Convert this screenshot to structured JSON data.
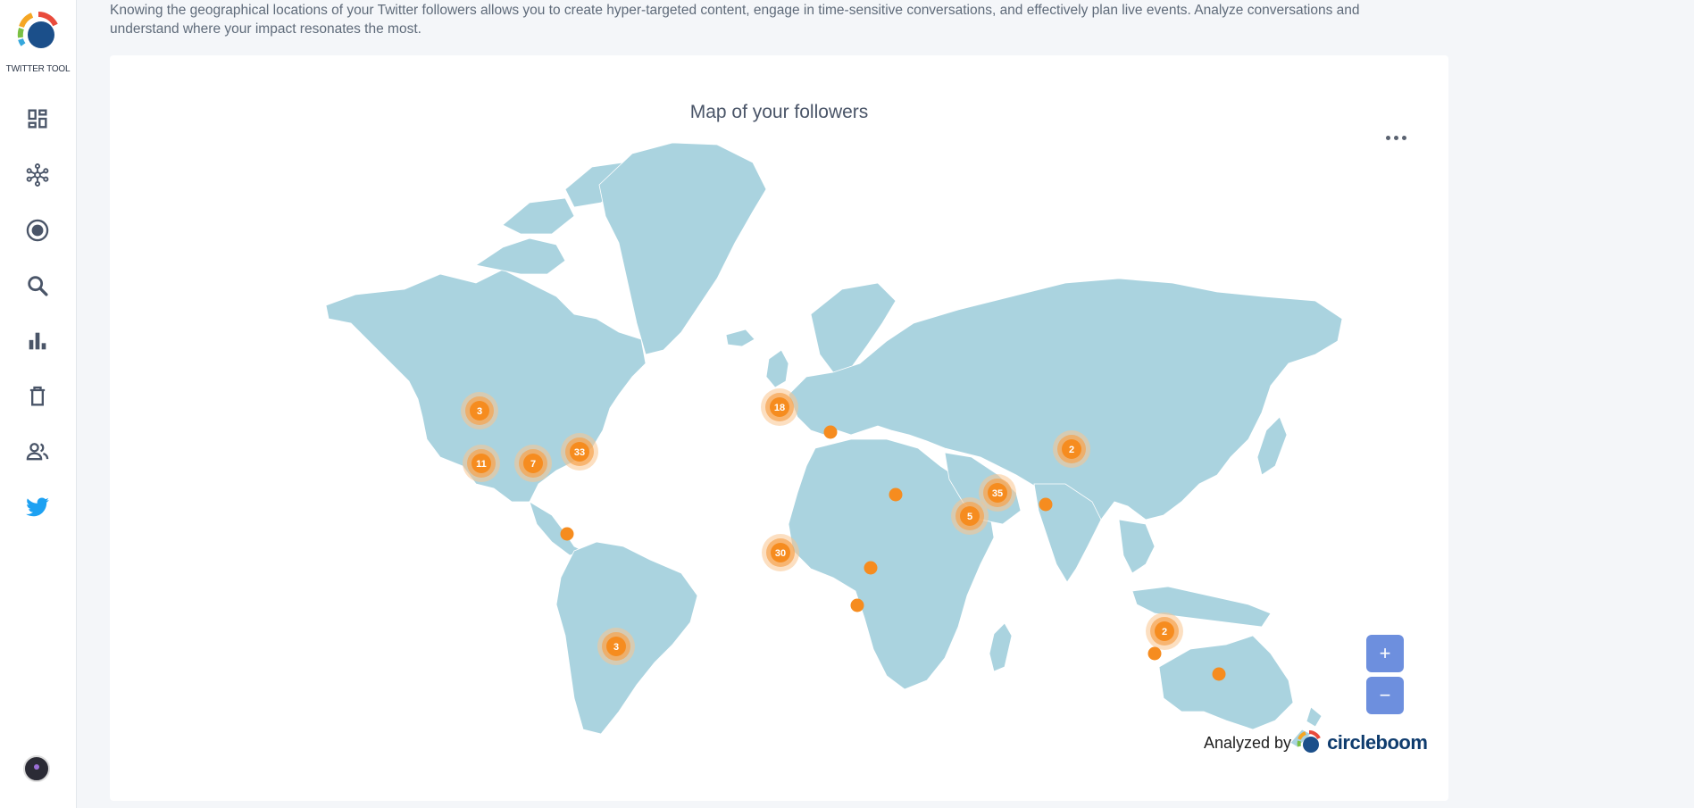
{
  "app": {
    "name": "TWITTER TOOL"
  },
  "sidebar": {
    "items": [
      {
        "icon": "dashboard-icon"
      },
      {
        "icon": "network-icon"
      },
      {
        "icon": "target-icon"
      },
      {
        "icon": "search-icon"
      },
      {
        "icon": "bar-chart-icon"
      },
      {
        "icon": "trash-icon"
      },
      {
        "icon": "people-icon"
      },
      {
        "icon": "twitter-icon"
      }
    ]
  },
  "description": "Knowing the geographical locations of your Twitter followers allows you to create hyper-targeted content, engage in time-sensitive conversations, and effectively plan live events. Analyze conversations and understand where your impact resonates the most.",
  "map": {
    "title": "Map of your followers",
    "clusters": [
      "3",
      "11",
      "7",
      "33",
      "3",
      "18",
      "30",
      "5",
      "35",
      "2",
      "2"
    ],
    "zoom_in_label": "+",
    "zoom_out_label": "−"
  },
  "footer": {
    "analyzed_by": "Analyzed by",
    "brand": "circleboom"
  },
  "colors": {
    "land": "#aad3df",
    "marker": "#f68c1f",
    "zoom": "#6d8fde",
    "twitter": "#1da1f2"
  }
}
